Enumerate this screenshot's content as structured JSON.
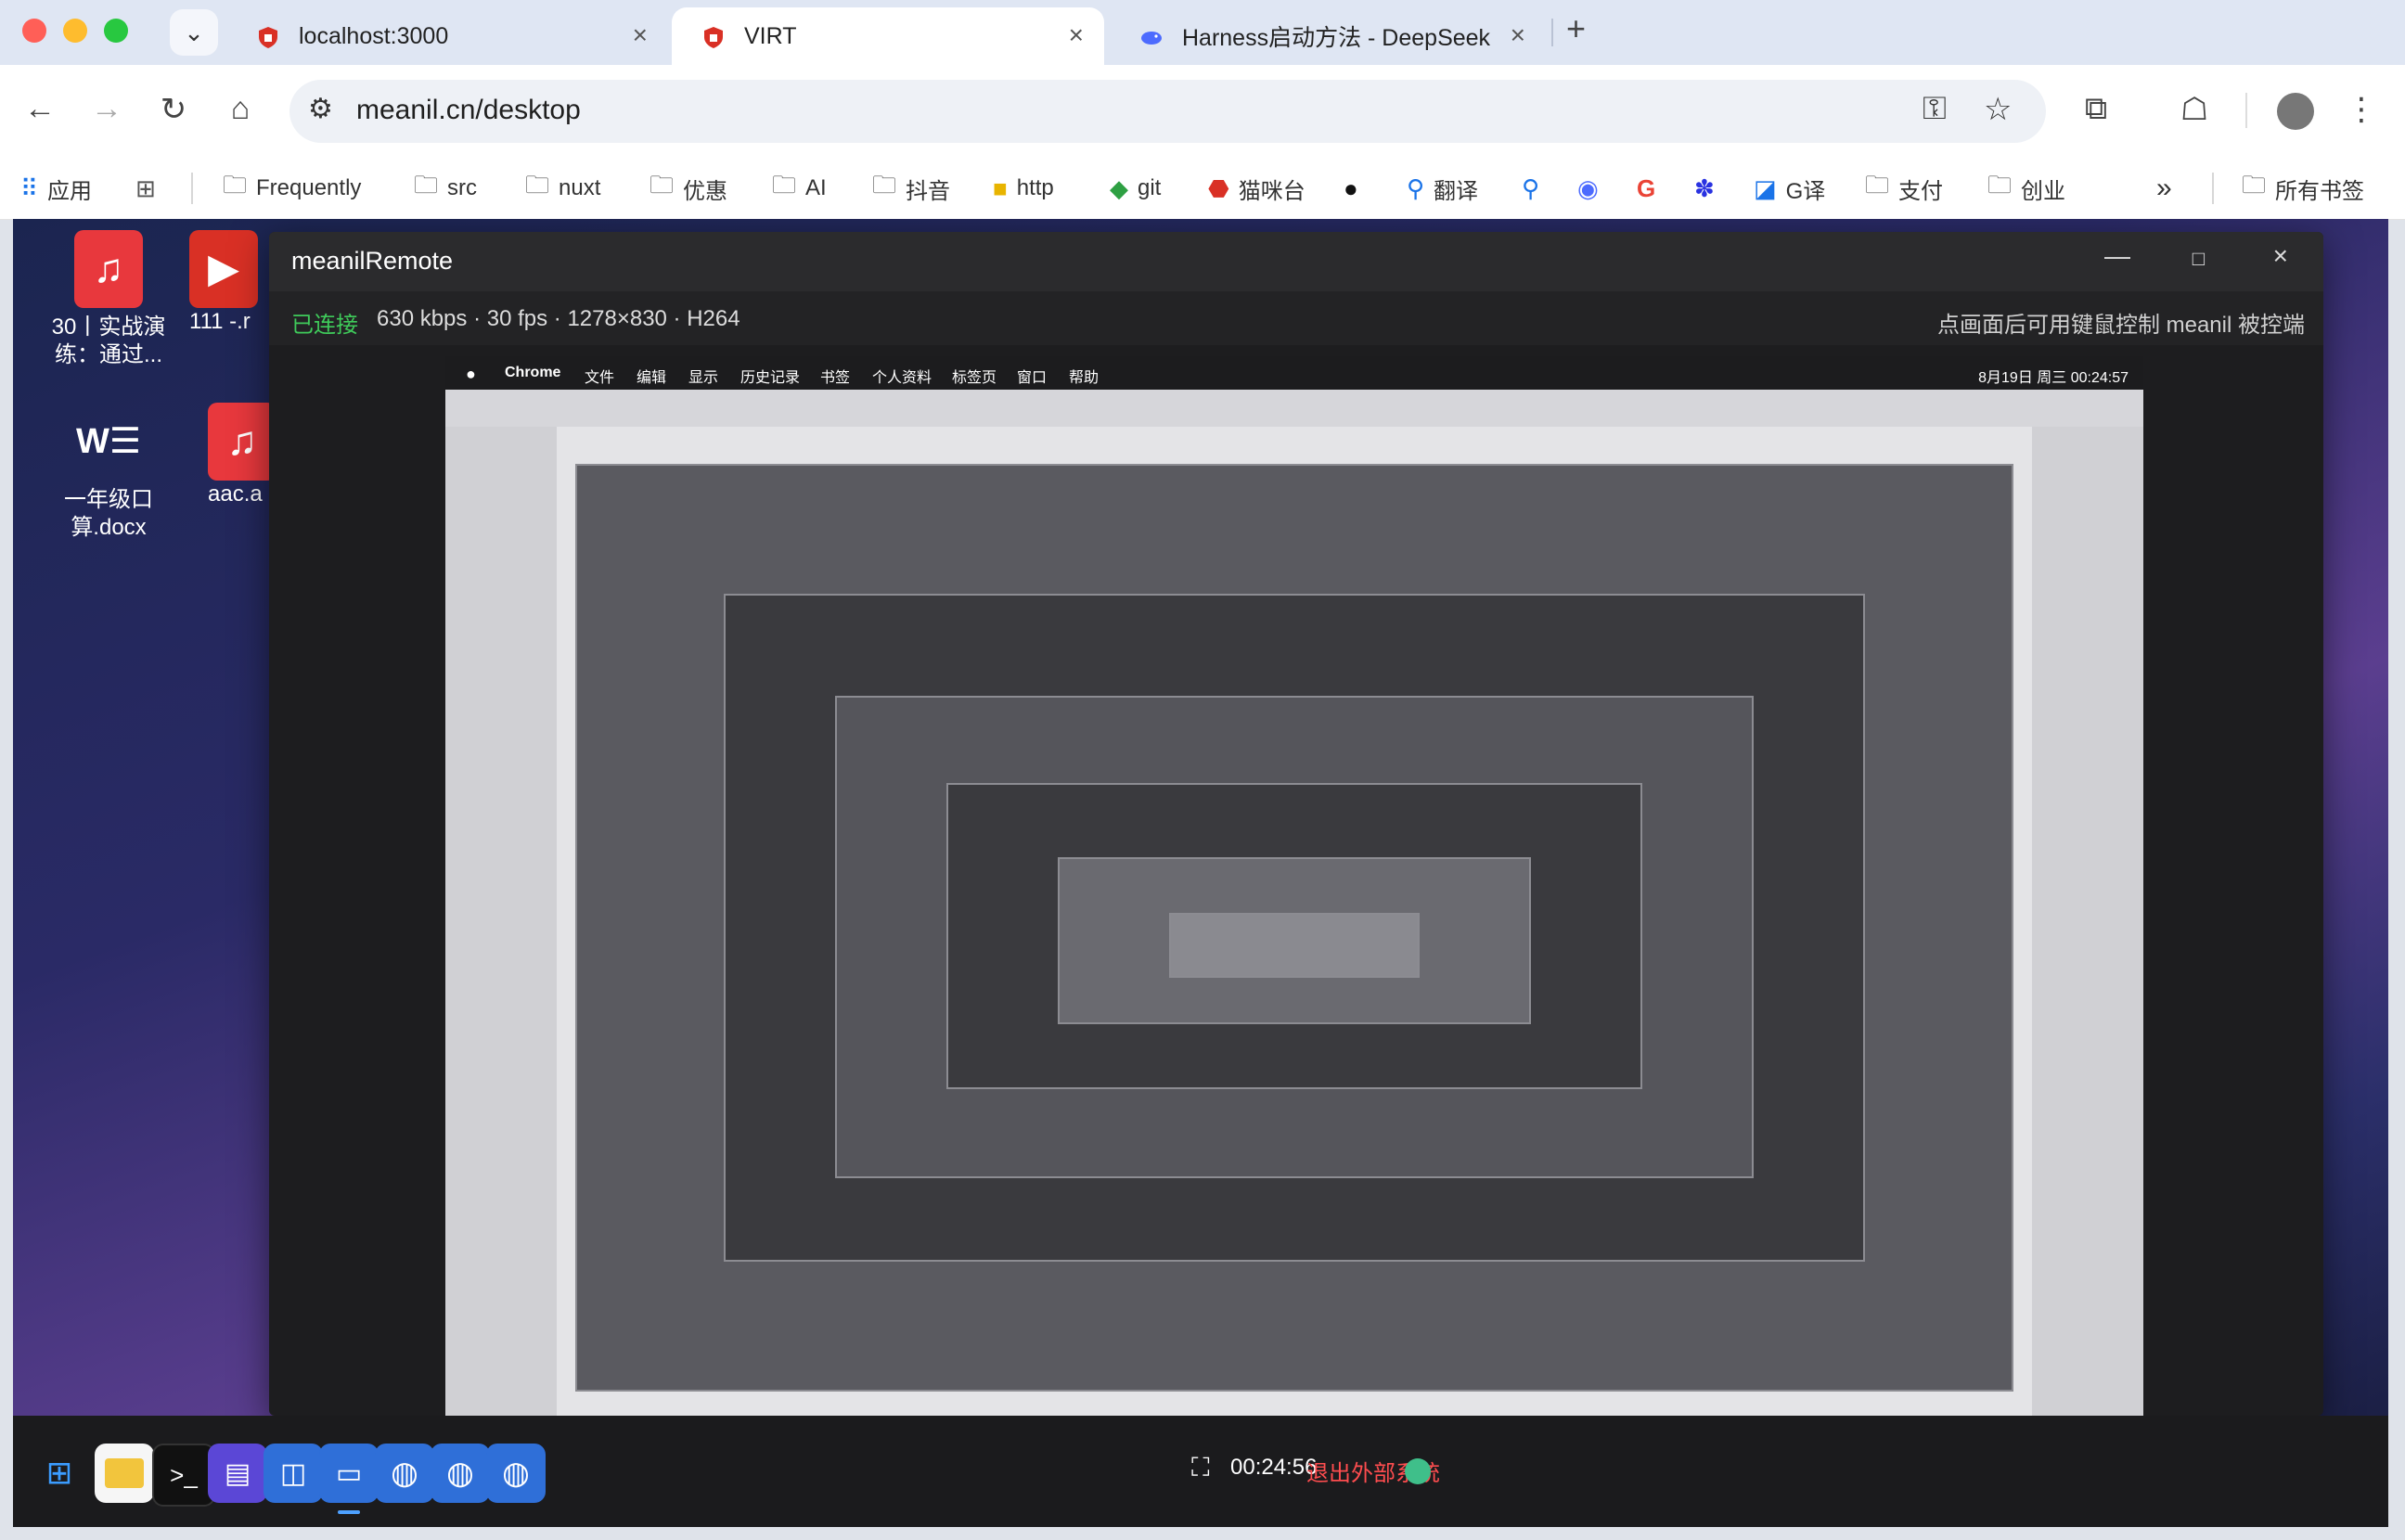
{
  "tabs": [
    {
      "label": "localhost:3000",
      "icon": "red-shield-icon"
    },
    {
      "label": "VIRT",
      "icon": "red-shield-icon"
    },
    {
      "label": "Harness启动方法 - DeepSeek",
      "icon": "deepseek-whale-icon"
    }
  ],
  "address": {
    "url": "meanil.cn/desktop"
  },
  "bookmarks": [
    {
      "label": "应用",
      "icon": "apps-grid-icon"
    },
    {
      "label": "Frequently",
      "icon": "folder-icon"
    },
    {
      "label": "src",
      "icon": "folder-icon"
    },
    {
      "label": "nuxt",
      "icon": "folder-icon"
    },
    {
      "label": "优惠",
      "icon": "folder-icon"
    },
    {
      "label": "AI",
      "icon": "folder-icon"
    },
    {
      "label": "抖音",
      "icon": "folder-icon"
    },
    {
      "label": "http",
      "icon": "http-cat-icon"
    },
    {
      "label": "git",
      "icon": "git-icon"
    },
    {
      "label": "猫咪台",
      "icon": "red-shield-icon"
    },
    {
      "label": "翻译",
      "icon": "search-icon"
    },
    {
      "label": "G译",
      "icon": "google-translate-icon"
    },
    {
      "label": "支付",
      "icon": "folder-icon"
    },
    {
      "label": "创业",
      "icon": "folder-icon"
    }
  ],
  "bookmarks_all": "所有书签",
  "desktop_icons": [
    {
      "label": "30丨实战演练：通过...",
      "icon": "music-file-icon"
    },
    {
      "label": "111 -.r",
      "icon": "video-file-icon"
    },
    {
      "label": "一年级口算.docx",
      "icon": "word-doc-icon"
    },
    {
      "label": "aac.a",
      "icon": "music-file-icon"
    }
  ],
  "remote_window": {
    "title": "meanilRemote",
    "status": "已连接",
    "stream_info": "630 kbps · 30 fps · 1278×830 · H264",
    "hint": "点画面后可用键鼠控制 meanil 被控端"
  },
  "mac_menu": [
    "Chrome",
    "文件",
    "编辑",
    "显示",
    "历史记录",
    "书签",
    "个人资料",
    "标签页",
    "窗口",
    "帮助"
  ],
  "mac_status_time": "8月19日 周三 00:24:57",
  "taskbar": {
    "time": "00:24:56",
    "exit_label": "退出外部系统"
  },
  "colors": {
    "connected": "#3fca5a",
    "exit": "#ff4d4f",
    "accent": "#1a73e8"
  }
}
